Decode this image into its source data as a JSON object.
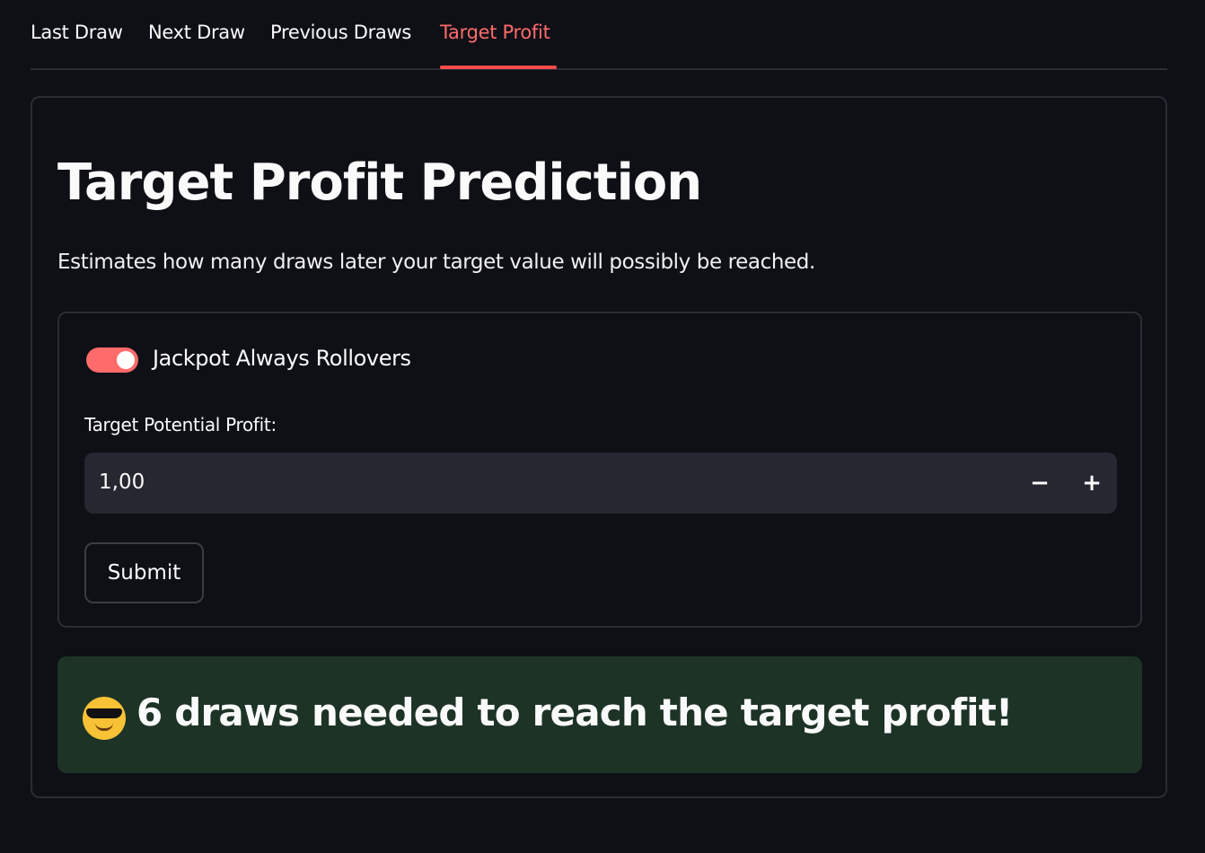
{
  "tabs": [
    {
      "label": "Last Draw"
    },
    {
      "label": "Next Draw"
    },
    {
      "label": "Previous Draws"
    },
    {
      "label": "Target Profit"
    }
  ],
  "active_tab": "Target Profit",
  "page": {
    "title": "Target Profit Prediction",
    "subtitle": "Estimates how many draws later your target value will possibly be reached."
  },
  "form": {
    "toggle_label": "Jackpot Always Rollovers",
    "toggle_on": true,
    "field_label": "Target Potential Profit:",
    "field_value": "1,00",
    "minus_label": "−",
    "plus_label": "+",
    "submit_label": "Submit"
  },
  "result": {
    "emoji_icon": "smiling-face-with-sunglasses-icon",
    "text": "6 draws needed to reach the target profit!"
  },
  "colors": {
    "accent": "#ff4b4b",
    "background": "#0e1016",
    "success_bg": "#1d3326"
  }
}
